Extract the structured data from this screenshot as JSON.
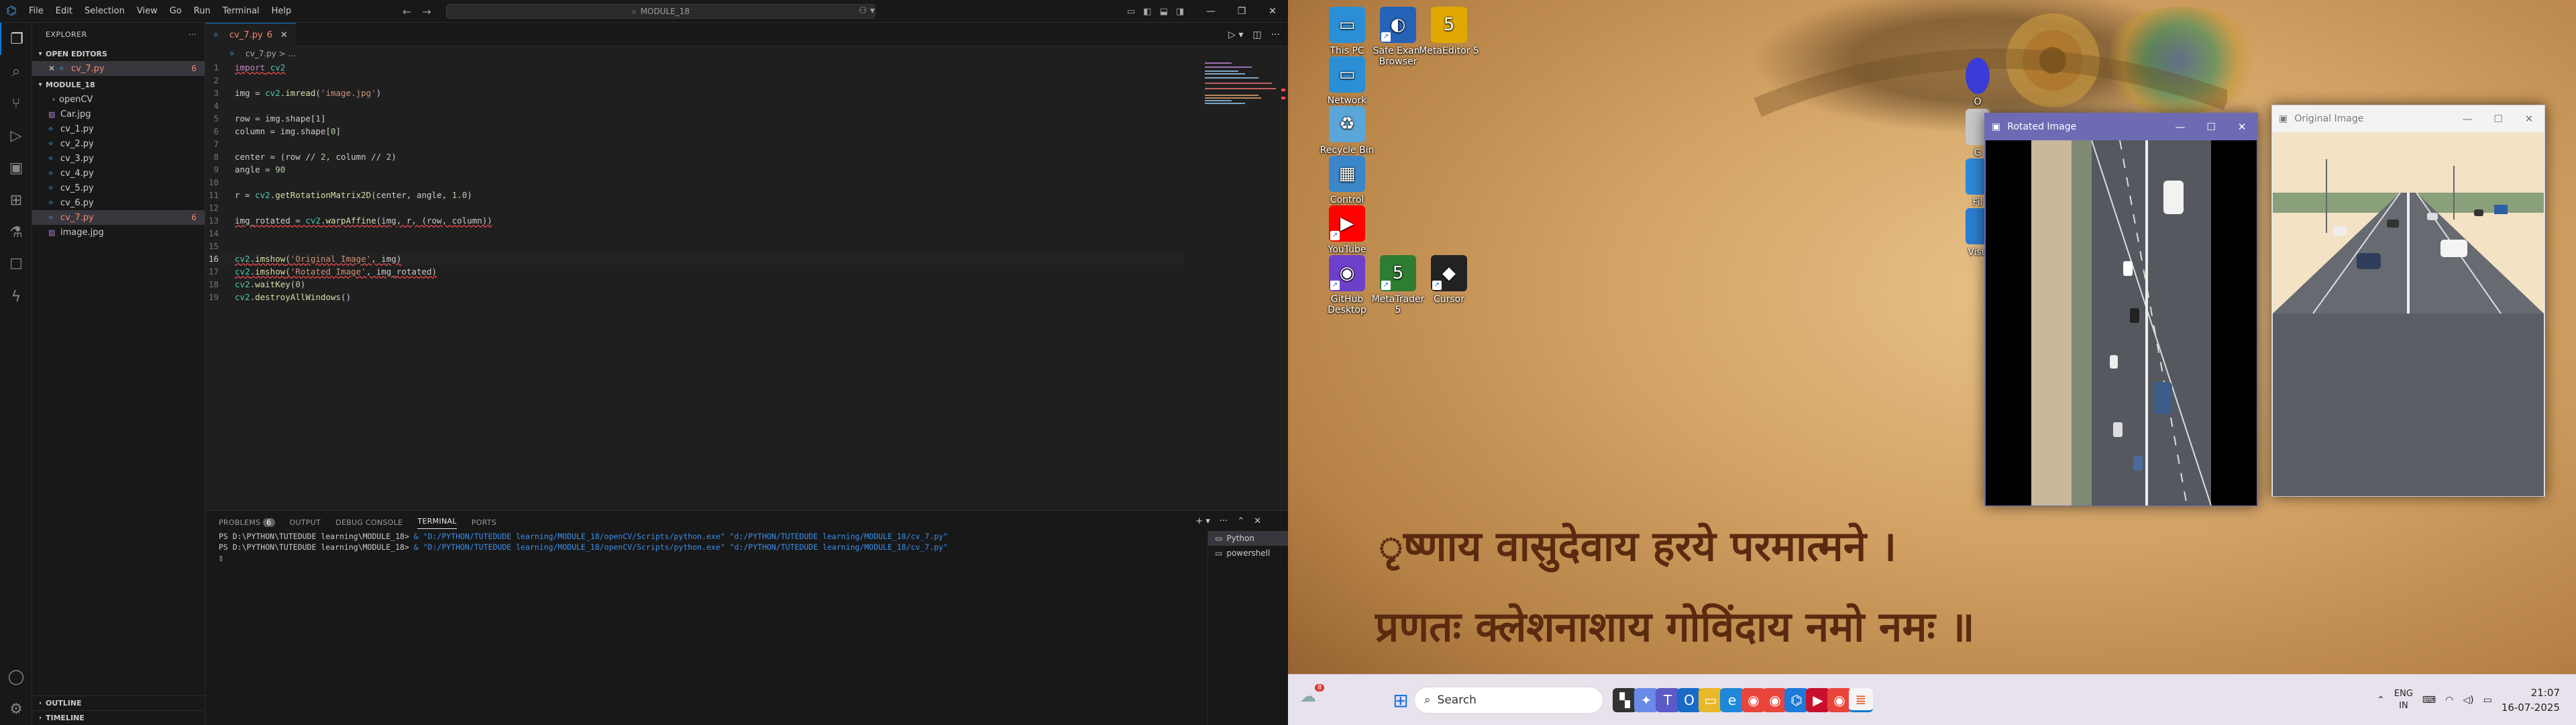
{
  "vscode": {
    "menu": [
      "File",
      "Edit",
      "Selection",
      "View",
      "Go",
      "Run",
      "Terminal",
      "Help"
    ],
    "command_center": "MODULE_18",
    "explorer": {
      "title": "EXPLORER",
      "open_editors_label": "OPEN EDITORS",
      "open_editor": {
        "name": "cv_7.py",
        "problems": "6"
      },
      "folder_label": "MODULE_18",
      "files": [
        {
          "name": "openCV",
          "kind": "folder"
        },
        {
          "name": "Car.jpg",
          "kind": "jpg"
        },
        {
          "name": "cv_1.py",
          "kind": "py"
        },
        {
          "name": "cv_2.py",
          "kind": "py"
        },
        {
          "name": "cv_3.py",
          "kind": "py"
        },
        {
          "name": "cv_4.py",
          "kind": "py"
        },
        {
          "name": "cv_5.py",
          "kind": "py"
        },
        {
          "name": "cv_6.py",
          "kind": "py"
        },
        {
          "name": "cv_7.py",
          "kind": "py",
          "problems": "6",
          "selected": true
        },
        {
          "name": "image.jpg",
          "kind": "jpg"
        }
      ],
      "outline_label": "OUTLINE",
      "timeline_label": "TIMELINE"
    },
    "tab": {
      "name": "cv_7.py",
      "count": "6"
    },
    "breadcrumb": "cv_7.py > ...",
    "code_lines": [
      "import cv2",
      "",
      "img = cv2.imread('image.jpg')",
      "",
      "row = img.shape[1]",
      "column = img.shape[0]",
      "",
      "center = (row // 2, column // 2)",
      "angle = 90",
      "",
      "r = cv2.getRotationMatrix2D(center, angle, 1.0)",
      "",
      "img_rotated = cv2.warpAffine(img, r, (row, column))",
      "",
      "",
      "cv2.imshow('Original Image', img)",
      "cv2.imshow('Rotated Image', img_rotated)",
      "cv2.waitKey(0)",
      "cv2.destroyAllWindows()"
    ],
    "current_line": 16,
    "panel_tabs": [
      "PROBLEMS",
      "OUTPUT",
      "DEBUG CONSOLE",
      "TERMINAL",
      "PORTS"
    ],
    "problems_count": "6",
    "active_panel_tab": "TERMINAL",
    "terminal": [
      {
        "prompt": "PS D:\\PYTHON\\TUTEDUDE learning\\MODULE_18> ",
        "cmd": "& \"D:/PYTHON/TUTEDUDE learning/MODULE_18/openCV/Scripts/python.exe\" \"d:/PYTHON/TUTEDUDE learning/MODULE_18/cv_7.py\""
      },
      {
        "prompt": "PS D:\\PYTHON\\TUTEDUDE learning\\MODULE_18> ",
        "cmd": "& \"D:/PYTHON/TUTEDUDE learning/MODULE_18/openCV/Scripts/python.exe\" \"d:/PYTHON/TUTEDUDE learning/MODULE_18/cv_7.py\""
      }
    ],
    "terminal_list": [
      "Python",
      "powershell"
    ]
  },
  "desktop": {
    "icons": [
      {
        "label": "This PC",
        "icon": "monitor-icon",
        "color": "#2b8fd6"
      },
      {
        "label": "Safe Exam Browser",
        "icon": "seb-icon",
        "color": "#2563b8"
      },
      {
        "label": "MetaEditor 5",
        "icon": "metaeditor-icon",
        "color": "#e0a800"
      },
      {
        "label": "Network",
        "icon": "network-icon",
        "color": "#2b8fd6"
      },
      {
        "label": "Recycle Bin",
        "icon": "recycle-bin-icon",
        "color": "#5aa6d8"
      },
      {
        "label": "Control Panel",
        "icon": "control-panel-icon",
        "color": "#3a86c8"
      },
      {
        "label": "YouTube",
        "icon": "youtube-icon",
        "color": "#ff0000"
      },
      {
        "label": "GitHub Desktop",
        "icon": "github-desktop-icon",
        "color": "#6e40c9"
      },
      {
        "label": "MetaTrader 5",
        "icon": "metatrader-icon",
        "color": "#2e7d32"
      },
      {
        "label": "Cursor",
        "icon": "cursor-icon",
        "color": "#222222"
      }
    ],
    "partial_icon_labels": [
      "O",
      "G",
      "Fil",
      "Visu"
    ],
    "mantra_line1": "ृष्णाय वासुदेवाय हरये परमात्मने ।",
    "mantra_line2": "प्रणतः क्लेशनाशाय गोविंदाय नमो नमः ॥",
    "rotated_window_title": "Rotated Image",
    "original_window_title": "Original Image",
    "taskbar": {
      "search_label": "Search",
      "weather_badge": "8",
      "language": "ENG",
      "region": "IN",
      "time": "21:07",
      "date": "16-07-2025"
    }
  }
}
